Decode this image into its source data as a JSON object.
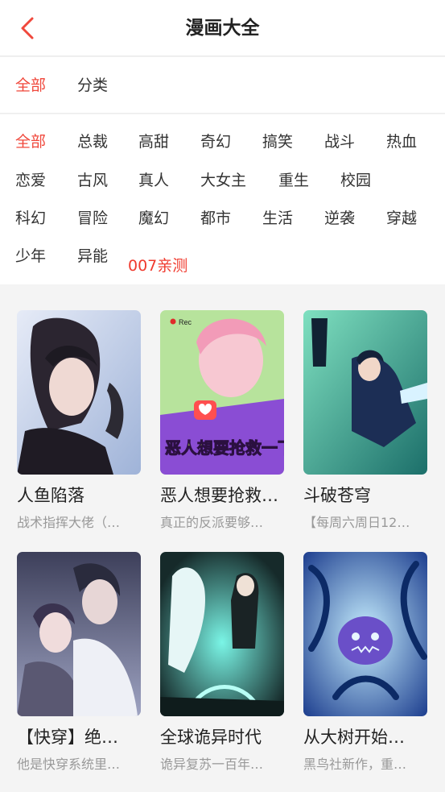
{
  "header": {
    "title": "漫画大全",
    "back_icon": "chevron-left-icon",
    "accent": "#f0483c"
  },
  "tabs": [
    {
      "label": "全部",
      "active": true
    },
    {
      "label": "分类",
      "active": false
    }
  ],
  "filters": {
    "rows": [
      [
        "全部",
        "总裁",
        "高甜",
        "奇幻",
        "搞笑",
        "战斗",
        "热血"
      ],
      [
        "恋爱",
        "古风",
        "真人",
        "大女主",
        "重生",
        "校园"
      ],
      [
        "科幻",
        "冒险",
        "魔幻",
        "都市",
        "生活",
        "逆袭",
        "穿越"
      ],
      [
        "少年",
        "异能"
      ]
    ],
    "active": "全部",
    "promo": "007亲测"
  },
  "comics": [
    {
      "title": "人鱼陷落",
      "desc": "战术指挥大佬（…",
      "palette": [
        "#c6cfe3",
        "#3a3340"
      ]
    },
    {
      "title": "恶人想要抢救…",
      "desc": "真正的反派要够…",
      "palette": [
        "#9fd28a",
        "#8a4dd4"
      ],
      "cover_badge": "Rec",
      "cover_text": "恶人想要抢救一下"
    },
    {
      "title": "斗破苍穹",
      "desc": "【每周六周日12…",
      "palette": [
        "#3aa88e",
        "#1c2e55"
      ]
    },
    {
      "title": "【快穿】绝…",
      "desc": "他是快穿系统里…",
      "palette": [
        "#4a4e6a",
        "#d9dce8"
      ]
    },
    {
      "title": "全球诡异时代",
      "desc": "诡异复苏一百年…",
      "palette": [
        "#1f3a3a",
        "#4fe0d2"
      ]
    },
    {
      "title": "从大树开始…",
      "desc": "黑鸟社新作，重…",
      "palette": [
        "#2a4fb0",
        "#8fd6ff"
      ]
    }
  ]
}
